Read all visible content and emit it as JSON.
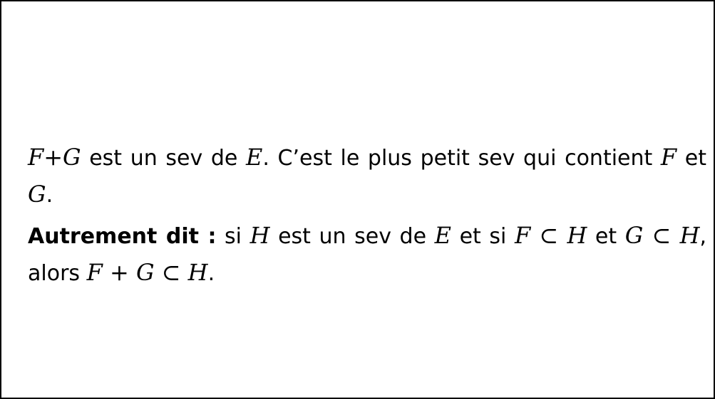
{
  "p1": {
    "F": "F",
    "plus": "+",
    "G": "G",
    "t1": " est un sev de ",
    "E": "E",
    "t2": ". C’est le plus petit sev qui contient ",
    "F2": "F",
    "t3": " et ",
    "G2": "G",
    "t4": "."
  },
  "p2": {
    "bold": "Autrement dit :",
    "t1": " si ",
    "H1": "H",
    "t2": " est un sev de ",
    "E": "E",
    "t3": " et si ",
    "F": "F",
    "subset1": " ⊂ ",
    "H2": "H",
    "t4": " et ",
    "G": "G",
    "subset2": " ⊂ ",
    "H3": "H",
    "t5": ", alors ",
    "F2": "F",
    "plus": " + ",
    "G2": "G",
    "subset3": " ⊂ ",
    "H4": "H",
    "t6": "."
  }
}
